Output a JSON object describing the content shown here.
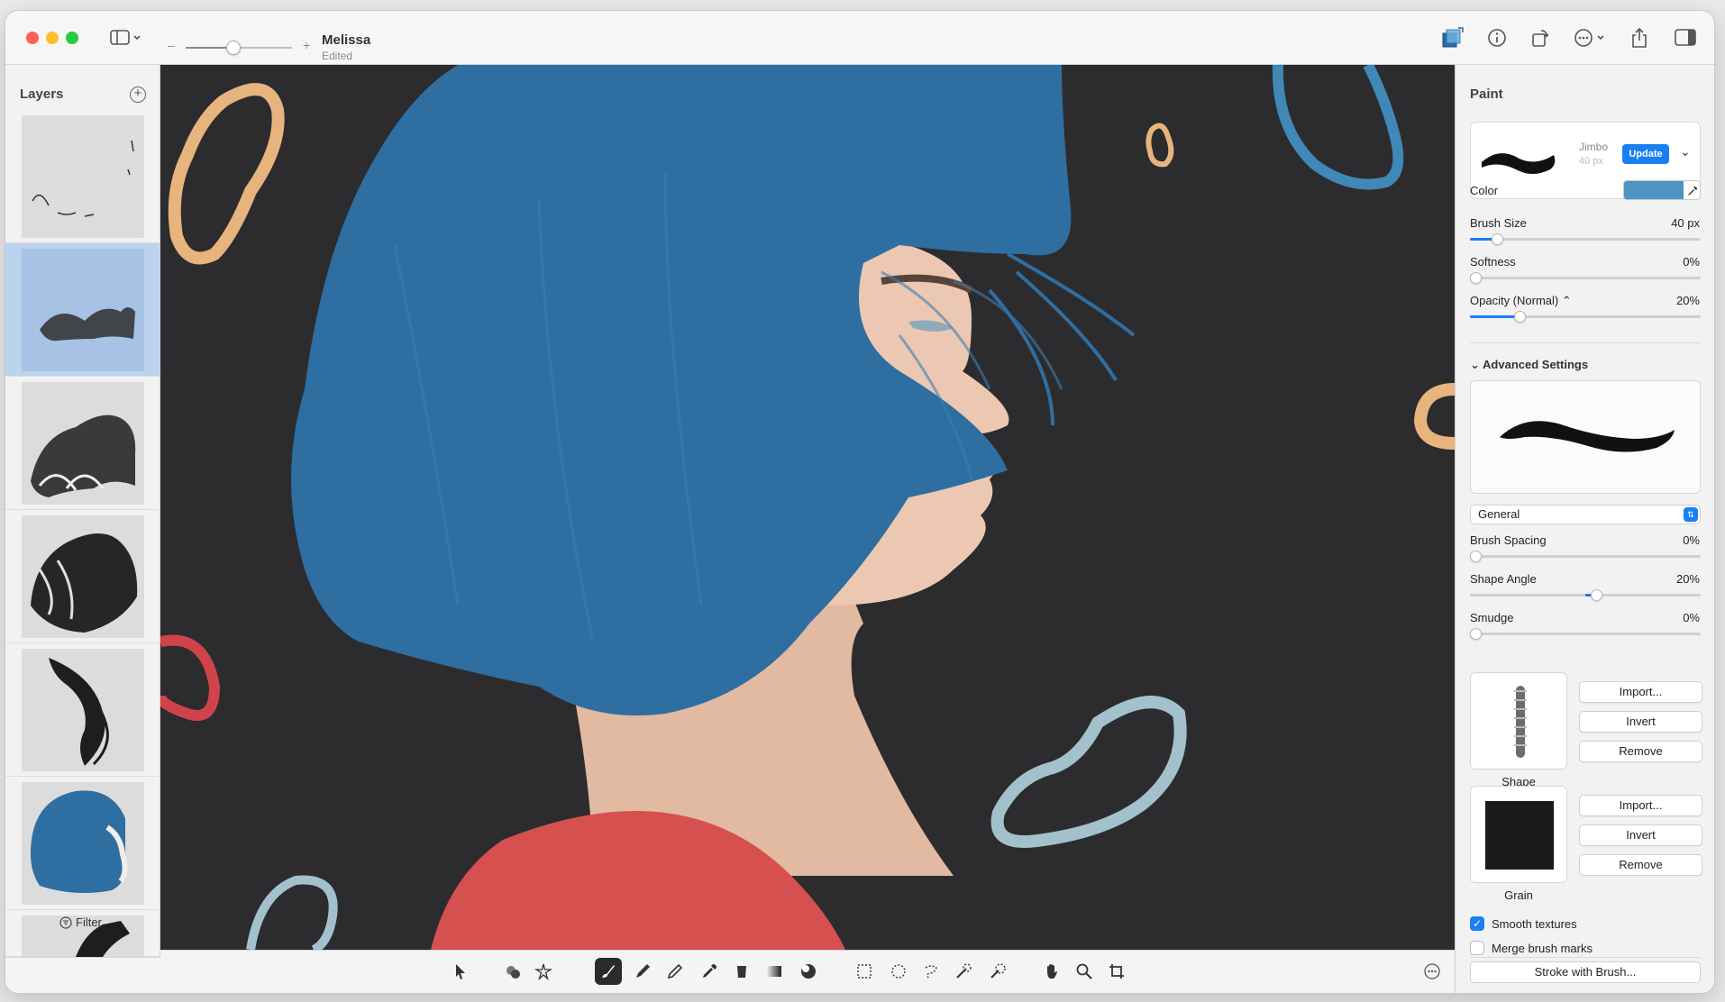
{
  "window": {
    "doc_title": "Melissa",
    "doc_status": "Edited",
    "zoom_minus": "–",
    "zoom_plus": "+",
    "zoom_level": 0.45
  },
  "toolbar_icons": [
    "sidebar-toggle-icon",
    "color-layers-icon",
    "info-icon",
    "rotate-icon",
    "more-icon",
    "share-icon",
    "inspector-toggle-icon"
  ],
  "layers": {
    "title": "Layers",
    "add_label": "+",
    "selected_index": 1,
    "filter_label": "Filter",
    "count_visible": 7
  },
  "tools": [
    "pointer",
    "shapes",
    "magic",
    "brush",
    "pen",
    "pencil",
    "eyedropper",
    "fill",
    "gradient",
    "blend",
    "rect-select",
    "ellipse-select",
    "lasso-select",
    "magic-select",
    "color-select",
    "hand",
    "zoom",
    "crop",
    "more"
  ],
  "paint": {
    "title": "Paint",
    "brush": {
      "name": "Jimbo",
      "size": "40 px",
      "update_label": "Update"
    },
    "color_label": "Color",
    "color_hex": "#4c95c2",
    "brush_size": {
      "label": "Brush Size",
      "value": "40 px",
      "level": 0.1
    },
    "softness": {
      "label": "Softness",
      "value": "0%",
      "level": 0.0
    },
    "opacity": {
      "label": "Opacity (Normal) ⌃",
      "value": "20%",
      "level": 0.2
    },
    "advanced_title": "Advanced Settings",
    "preset": "General",
    "brush_spacing": {
      "label": "Brush Spacing",
      "value": "0%",
      "level": 0.0
    },
    "shape_angle": {
      "label": "Shape Angle",
      "value": "20%",
      "level": 0.55
    },
    "smudge": {
      "label": "Smudge",
      "value": "0%",
      "level": 0.0
    },
    "shape": {
      "caption": "Shape",
      "import": "Import...",
      "invert": "Invert",
      "remove": "Remove"
    },
    "grain": {
      "caption": "Grain",
      "import": "Import...",
      "invert": "Invert",
      "remove": "Remove"
    },
    "smooth_textures": {
      "label": "Smooth textures",
      "checked": true
    },
    "merge_marks": {
      "label": "Merge brush marks",
      "checked": false
    },
    "stroke_button": "Stroke with Brush..."
  },
  "colors": {
    "accent": "#1a7ff1",
    "canvas_bg": "#2c2c2e",
    "hair": "#2f6ea1",
    "skin": "#e9c8b2",
    "shirt": "#d6504f",
    "shape_orange": "#e7b47e",
    "shape_blue": "#3f88b8",
    "shape_light": "#a3c1cd",
    "shape_red": "#d0434a"
  }
}
